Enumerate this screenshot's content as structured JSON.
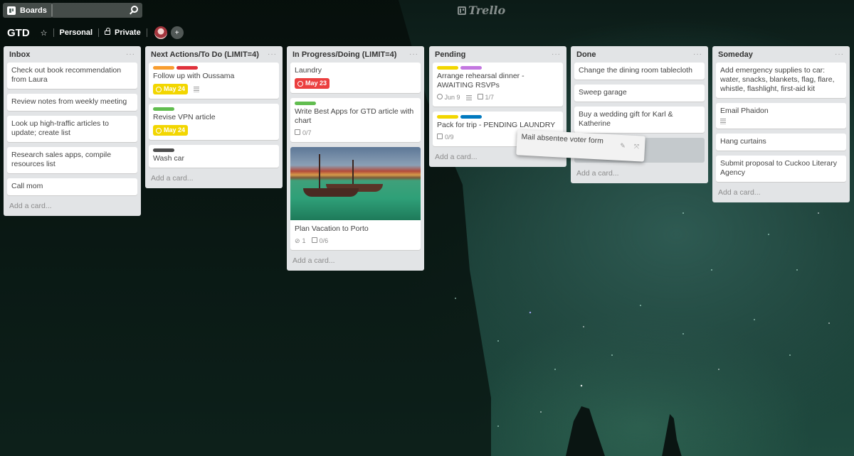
{
  "topbar": {
    "boards_label": "Boards",
    "search_placeholder": "",
    "logo_text": "Trello"
  },
  "board": {
    "title": "GTD",
    "team": "Personal",
    "visibility": "Private"
  },
  "add_card_label": "Add a card...",
  "lists": [
    {
      "title": "Inbox",
      "cards": [
        {
          "title": "Check out book recommendation from Laura"
        },
        {
          "title": "Review notes from weekly meeting"
        },
        {
          "title": "Look up high-traffic articles to update; create list"
        },
        {
          "title": "Research sales apps, compile resources list"
        },
        {
          "title": "Call mom"
        }
      ]
    },
    {
      "title": "Next Actions/To Do (LIMIT=4)",
      "cards": [
        {
          "title": "Follow up with Oussama",
          "labels": [
            "#f89d2f",
            "#e0313b"
          ],
          "due": "May 24",
          "due_color": "#f2d600",
          "has_description": true
        },
        {
          "title": "Revise VPN article",
          "labels": [
            "#61bd4f"
          ],
          "due": "May 24",
          "due_color": "#f2d600"
        },
        {
          "title": "Wash car",
          "labels": [
            "#4d4d4d"
          ]
        }
      ]
    },
    {
      "title": "In Progress/Doing (LIMIT=4)",
      "cards": [
        {
          "title": "Laundry",
          "due": "May 23",
          "due_color": "#eb3f3f"
        },
        {
          "title": "Write Best Apps for GTD article with chart",
          "labels": [
            "#61bd4f"
          ],
          "checklist": "0/7"
        },
        {
          "title": "Plan Vacation to Porto",
          "has_cover": true,
          "attachments": "1",
          "checklist": "0/6"
        }
      ]
    },
    {
      "title": "Pending",
      "cards": [
        {
          "title": "Arrange rehearsal dinner - AWAITING RSVPs",
          "labels": [
            "#f2d600",
            "#c377e0"
          ],
          "due": "Jun 9",
          "has_description": true,
          "checklist": "1/7"
        },
        {
          "title": "Pack for trip - PENDING LAUNDRY",
          "labels": [
            "#f2d600",
            "#0079bf"
          ],
          "checklist": "0/9"
        }
      ]
    },
    {
      "title": "Done",
      "cards": [
        {
          "title": "Change the dining room tablecloth"
        },
        {
          "title": "Sweep garage"
        },
        {
          "title": "Buy a wedding gift for Karl & Katherine"
        }
      ]
    },
    {
      "title": "Someday",
      "cards": [
        {
          "title": "Add emergency supplies to car: water, snacks, blankets, flag, flare, whistle, flashlight, first-aid kit"
        },
        {
          "title": "Email Phaidon",
          "has_description": true
        },
        {
          "title": "Hang curtains"
        },
        {
          "title": "Submit proposal to Cuckoo Literary Agency"
        }
      ]
    }
  ],
  "dragging_card": {
    "title": "Mail absentee voter form",
    "labels": [
      "#333333"
    ]
  }
}
